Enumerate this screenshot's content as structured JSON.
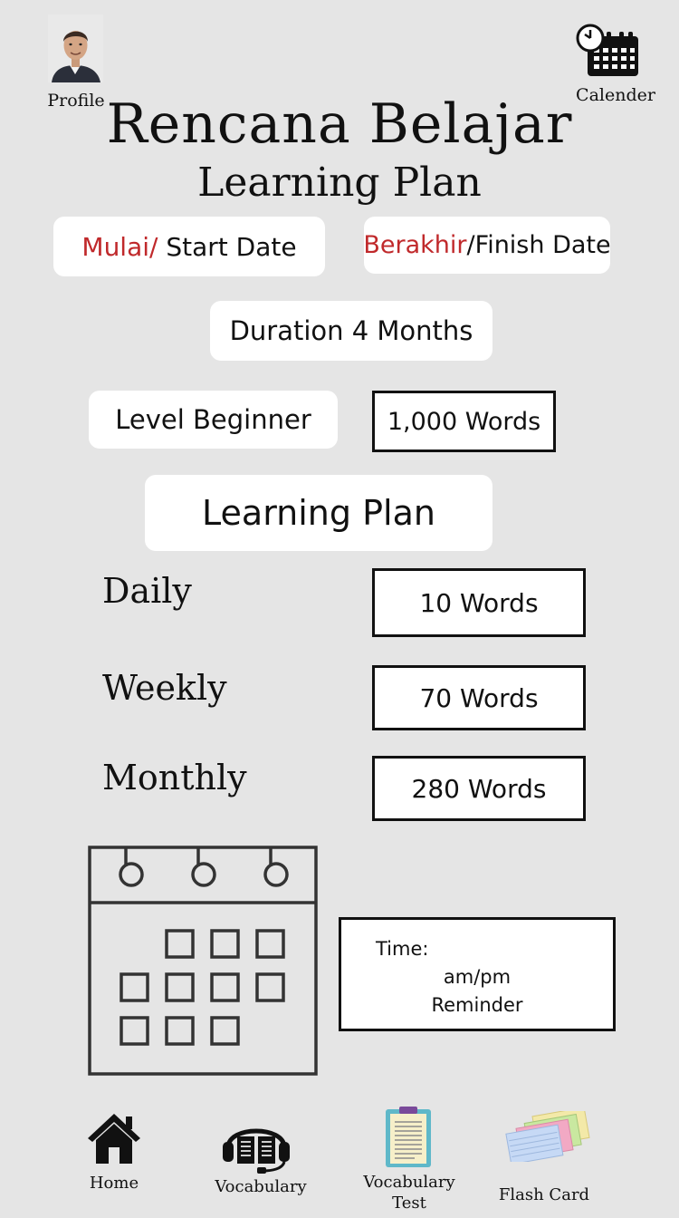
{
  "header": {
    "profile_label": "Profile",
    "calendar_label": "Calender",
    "title": "Rencana Belajar",
    "subtitle": "Learning Plan"
  },
  "dates": {
    "start_prefix": "Mulai/",
    "start_label": " Start Date",
    "finish_prefix": "Berakhir",
    "finish_label": "/Finish Date"
  },
  "duration": "Duration 4 Months",
  "level": "Level Beginner",
  "total_words": "1,000 Words",
  "plan_header": "Learning Plan",
  "plan": [
    {
      "label": "Daily",
      "value": "10 Words"
    },
    {
      "label": "Weekly",
      "value": "70 Words"
    },
    {
      "label": "Monthly",
      "value": "280 Words"
    }
  ],
  "reminder": {
    "time_label": "Time:",
    "ampm": "am/pm",
    "text": "Reminder"
  },
  "nav": {
    "home": "Home",
    "vocabulary": "Vocabulary",
    "vocabulary_test_line1": "Vocabulary",
    "vocabulary_test_line2": "Test",
    "flash_card": "Flash Card"
  },
  "colors": {
    "background": "#e5e5e5",
    "accent_red": "#c0292b",
    "card": "#ffffff"
  },
  "icons": [
    "avatar",
    "calendar-icon",
    "home-icon",
    "headphones-book-icon",
    "clipboard-icon",
    "flash-cards-icon"
  ]
}
